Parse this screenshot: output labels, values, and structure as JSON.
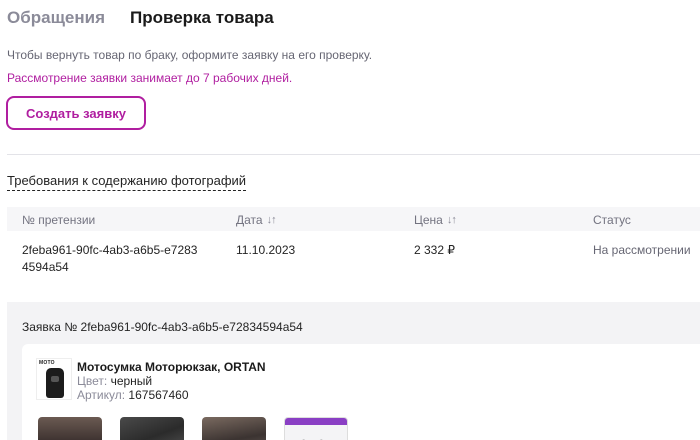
{
  "tabs": [
    {
      "label": "Обращения",
      "active": false
    },
    {
      "label": "Проверка товара",
      "active": true
    }
  ],
  "info_text": "Чтобы вернуть товар по браку, оформите заявку на его проверку.",
  "notice_text": "Рассмотрение заявки занимает до 7 рабочих дней.",
  "create_button": "Создать заявку",
  "requirements_link": "Требования к содержанию фотографий",
  "table": {
    "headers": {
      "claim": "№ претензии",
      "date": "Дата",
      "price": "Цена",
      "status": "Статус"
    },
    "rows": [
      {
        "claim": "2feba961-90fc-4ab3-a6b5-e72834594a54",
        "date": "11.10.2023",
        "price": "2 332 ₽",
        "status": "На рассмотрении"
      }
    ]
  },
  "request": {
    "title": "Заявка № 2feba961-90fc-4ab3-a6b5-e72834594a54",
    "product": {
      "brand_mark": "MOTO",
      "name": "Мотосумка Моторюкзак, ORTAN",
      "color_label": "Цвет:",
      "color_value": "черный",
      "article_label": "Артикул:",
      "article_value": "167567460"
    }
  },
  "colors": {
    "accent": "#b01ea0",
    "muted": "#8b8b99",
    "panel_bg": "#f3f3f5"
  },
  "icons": {
    "sort": "sort-arrows-icon"
  }
}
